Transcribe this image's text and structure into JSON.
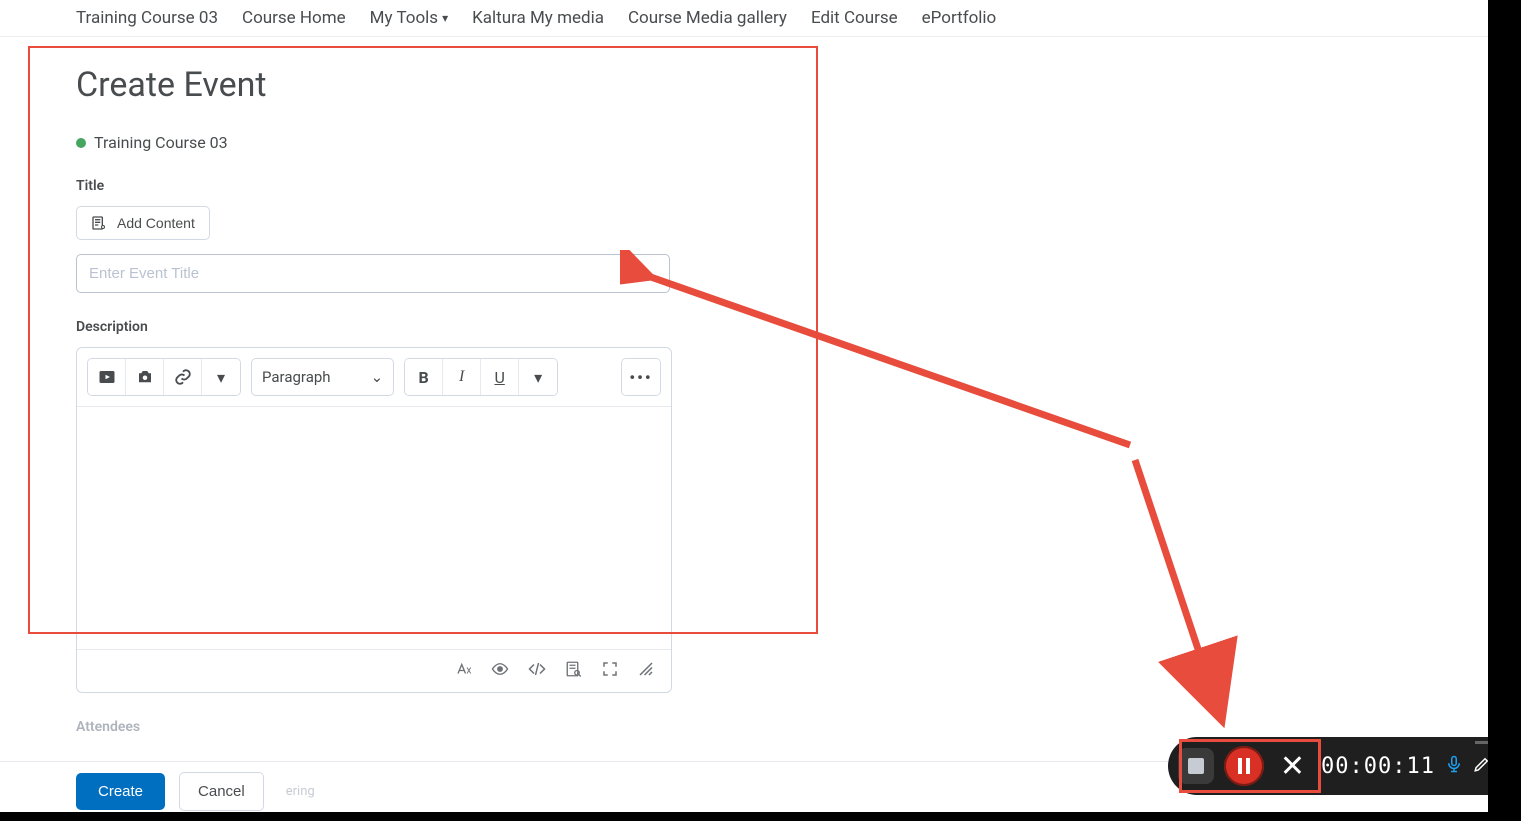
{
  "nav": {
    "items": [
      "Training Course 03",
      "Course Home",
      "My Tools",
      "Kaltura My media",
      "Course Media gallery",
      "Edit Course",
      "ePortfolio"
    ]
  },
  "page": {
    "heading": "Create Event",
    "breadcrumb": "Training Course 03",
    "title_label": "Title",
    "add_content_label": "Add Content",
    "title_placeholder": "Enter Event Title",
    "description_label": "Description",
    "paragraph_label": "Paragraph",
    "attendees_label": "Attendees",
    "ghost_text": "ering"
  },
  "footer": {
    "create": "Create",
    "cancel": "Cancel"
  },
  "recorder": {
    "time": "00:00:11"
  },
  "icons": {
    "video": "video-icon",
    "camera": "camera-icon",
    "link": "link-icon",
    "caret": "caret-icon",
    "bold": "bold-icon",
    "italic": "italic-icon",
    "underline": "underline-icon",
    "more": "more-icon",
    "font": "font-icon",
    "eye": "eye-icon",
    "code": "code-icon",
    "find": "find-icon",
    "expand": "expand-icon",
    "scribble": "scribble-icon"
  }
}
